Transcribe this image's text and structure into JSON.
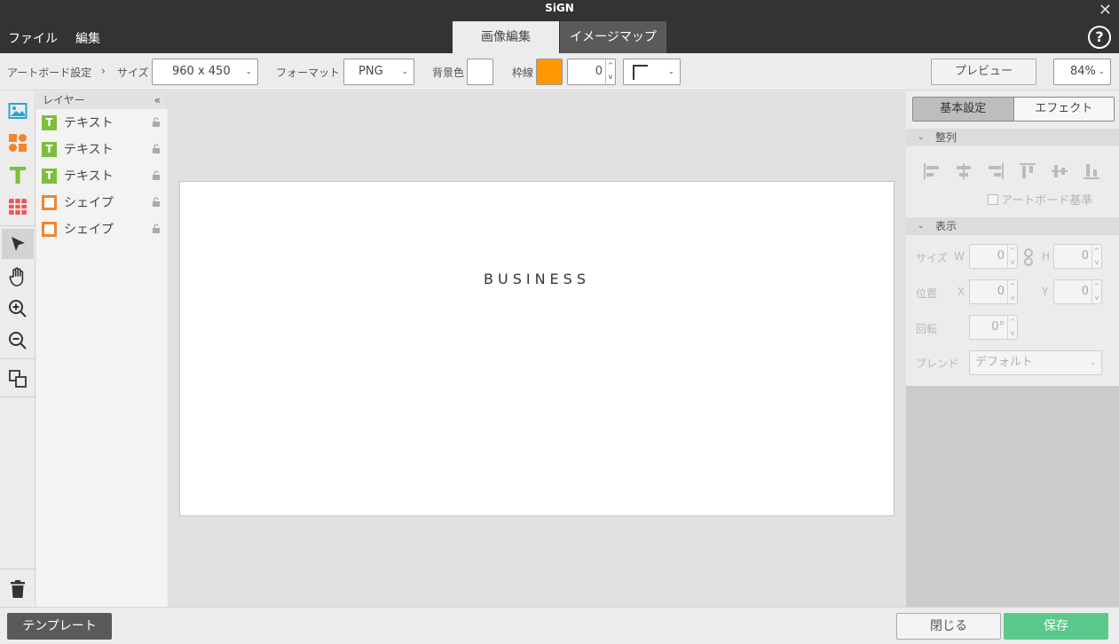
{
  "app": {
    "title": "SiGN",
    "menu": [
      "ファイル",
      "編集"
    ],
    "tabs": [
      {
        "label": "画像編集",
        "active": true
      },
      {
        "label": "イメージマップ",
        "active": false
      }
    ],
    "help_label": "?",
    "close_label": "✕"
  },
  "toolbar": {
    "breadcrumb": "アートボード設定",
    "breadcrumb_sep": "›",
    "size_label": "サイズ",
    "size_value": "960 x 450",
    "format_label": "フォーマット",
    "format_value": "PNG",
    "bg_label": "背景色",
    "bg_color": "#ffffff",
    "border_label": "枠線",
    "border_color": "#ff9800",
    "border_width": "0",
    "preview_label": "プレビュー",
    "zoom_value": "84%"
  },
  "tools": [
    "image-tool",
    "shape-tool",
    "text-tool",
    "table-tool",
    "select-tool",
    "hand-tool",
    "zoom-in-tool",
    "zoom-out-tool",
    "arrange-tool",
    "delete-tool"
  ],
  "layers": {
    "header": "レイヤー",
    "collapse": "«",
    "items": [
      {
        "type": "text",
        "name": "テキスト"
      },
      {
        "type": "text",
        "name": "テキスト"
      },
      {
        "type": "text",
        "name": "テキスト"
      },
      {
        "type": "shape",
        "name": "シェイプ"
      },
      {
        "type": "shape",
        "name": "シェイプ"
      }
    ]
  },
  "canvas": {
    "text": "BUSINESS"
  },
  "panel": {
    "tab_basic": "基本設定",
    "tab_effect": "エフェクト",
    "align_header": "整列",
    "artboard_basis": "アートボード基準",
    "display_header": "表示",
    "size_label": "サイズ",
    "w_label": "W",
    "w_value": "0",
    "h_label": "H",
    "h_value": "0",
    "position_label": "位置",
    "x_label": "X",
    "x_value": "0",
    "y_label": "Y",
    "y_value": "0",
    "rotation_label": "回転",
    "rotation_value": "0°",
    "blend_label": "ブレンド",
    "blend_value": "デフォルト"
  },
  "footer": {
    "template_label": "テンプレート",
    "close_label": "閉じる",
    "save_label": "保存"
  }
}
